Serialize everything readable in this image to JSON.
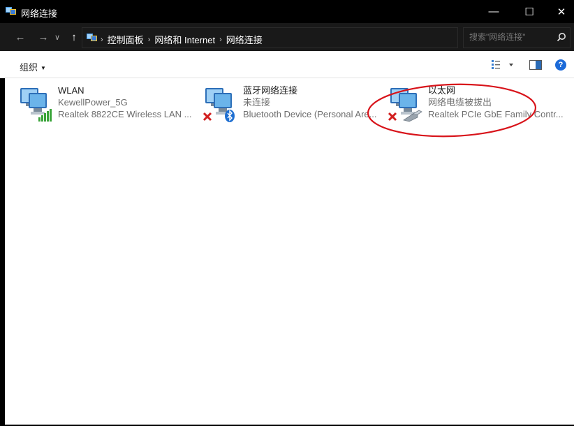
{
  "window": {
    "title": "网络连接",
    "minimize": "—",
    "maximize": "☐",
    "close": "✕"
  },
  "address": {
    "back": "←",
    "forward": "→",
    "history": "∨",
    "up": "↑",
    "breadcrumb": [
      "控制面板",
      "网络和 Internet",
      "网络连接"
    ],
    "separator": "›",
    "dropdown": "∨",
    "refresh": "↻"
  },
  "search": {
    "placeholder": "搜索\"网络连接\""
  },
  "toolbar": {
    "organize": "组织",
    "organize_caret": "▼",
    "help": "?"
  },
  "connections": [
    {
      "name": "WLAN",
      "status": "KewellPower_5G",
      "device": "Realtek 8822CE Wireless LAN ...",
      "icon": "wifi-adapter-icon"
    },
    {
      "name": "蓝牙网络连接",
      "status": "未连接",
      "device": "Bluetooth Device (Personal Are...",
      "icon": "bluetooth-adapter-icon"
    },
    {
      "name": "以太网",
      "status": "网络电缆被拔出",
      "device": "Realtek PCIe GbE Family Contr...",
      "icon": "ethernet-adapter-icon"
    }
  ],
  "colors": {
    "annotation": "#d8131a",
    "disconnected_x": "#d21f1f",
    "help_blue": "#1c6ad8"
  }
}
